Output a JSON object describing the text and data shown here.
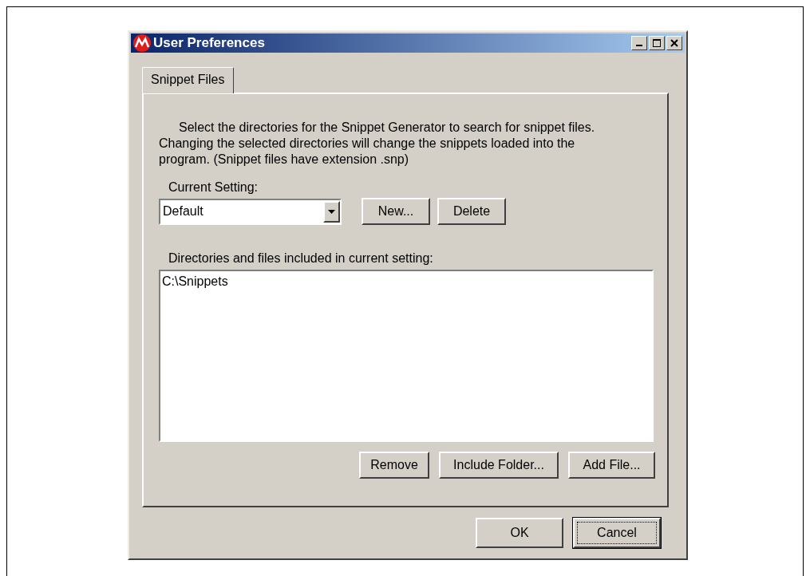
{
  "window": {
    "title": "User Preferences"
  },
  "tabs": [
    {
      "label": "Snippet Files",
      "selected": true
    }
  ],
  "description_lines": [
    "Select the directories for the Snippet Generator to search for snippet files.",
    "Changing the selected directories will change the snippets loaded into the",
    "program.  (Snippet files have extension .snp)"
  ],
  "current_setting": {
    "label": "Current Setting:",
    "value": "Default",
    "buttons": [
      "New...",
      "Delete"
    ]
  },
  "directories": {
    "label": "Directories and files included in current setting:",
    "items": [
      "C:\\Snippets"
    ],
    "buttons": [
      "Remove",
      "Include Folder...",
      "Add File..."
    ]
  },
  "dialog_buttons": [
    {
      "label": "OK",
      "focused": false
    },
    {
      "label": "Cancel",
      "focused": true
    }
  ]
}
